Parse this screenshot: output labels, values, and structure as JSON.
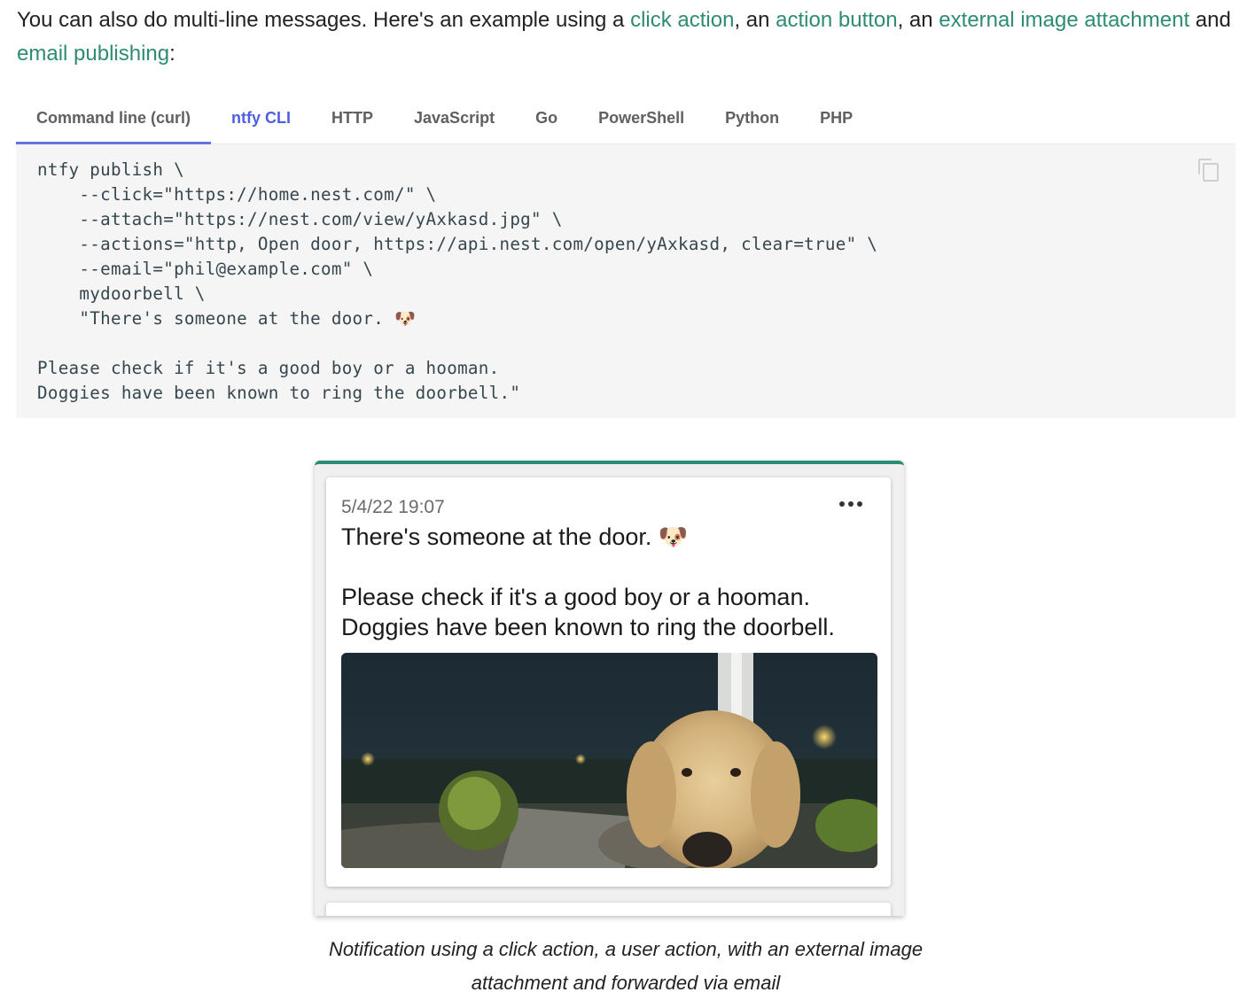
{
  "intro": {
    "text_before": "You can also do multi-line messages. Here's an example using a ",
    "link_click_action": "click action",
    "sep1": ", an ",
    "link_action_button": "action button",
    "sep2": ", an ",
    "link_external_image": "external image attachment",
    "sep3": " and ",
    "link_email_publishing": "email publishing",
    "text_after": ":"
  },
  "tabs": [
    {
      "label": "Command line (curl)",
      "underlined": true
    },
    {
      "label": "ntfy CLI",
      "active": true
    },
    {
      "label": "HTTP"
    },
    {
      "label": "JavaScript"
    },
    {
      "label": "Go"
    },
    {
      "label": "PowerShell"
    },
    {
      "label": "Python"
    },
    {
      "label": "PHP"
    }
  ],
  "code": {
    "lines": [
      "ntfy publish \\",
      "    --click=\"https://home.nest.com/\" \\",
      "    --attach=\"https://nest.com/view/yAxkasd.jpg\" \\",
      "    --actions=\"http, Open door, https://api.nest.com/open/yAxkasd, clear=true\" \\",
      "    --email=\"phil@example.com\" \\",
      "    mydoorbell \\",
      "    \"There's someone at the door. 🐶",
      "",
      "Please check if it's a good boy or a hooman.",
      "Doggies have been known to ring the doorbell.\""
    ],
    "copy_icon": "copy-icon"
  },
  "notification": {
    "date": "5/4/22 19:07",
    "menu_icon": "more-horizontal-icon",
    "message_line1": "There's someone at the door. 🐶",
    "message_rest": "Please check if it's a good boy or a hooman.\nDoggies have been known to ring the doorbell.",
    "accent_color": "#2e8b74"
  },
  "caption": "Notification using a click action, a user action, with an external image attachment and forwarded via email",
  "colors": {
    "link": "#2e8b74",
    "tab_active": "#4e5fe0",
    "tab_underline": "#6373e0",
    "code_bg": "#f5f5f5"
  }
}
